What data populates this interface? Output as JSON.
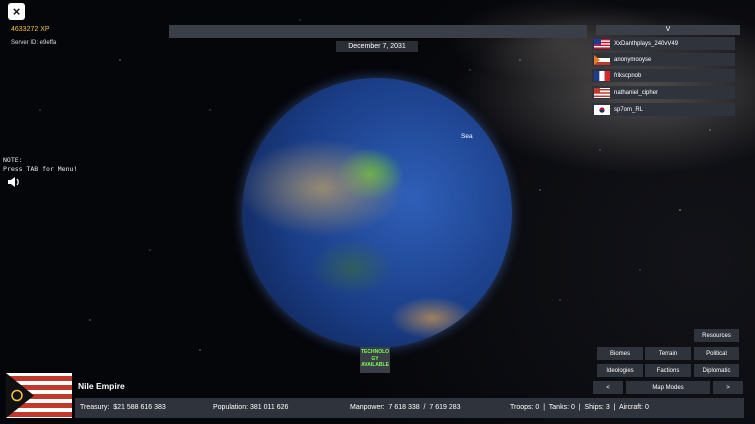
{
  "hud": {
    "xp": "4633272 XP",
    "server_id": "Server ID: e9effa",
    "note_line1": "NOTE:",
    "note_line2": "Press TAB for Menu!",
    "date": "December 7, 2031",
    "sea_label": "Sea",
    "tech_line1": "TECHNOLO",
    "tech_line2": "GY",
    "tech_line3": "AVAILABLE",
    "close_icon": "×"
  },
  "players": {
    "header": "V",
    "list": [
      {
        "name": "XxDanthplays_240vV49",
        "flag": "usa"
      },
      {
        "name": "anonymooyse",
        "flag": "striped"
      },
      {
        "name": "frikscpnob",
        "flag": "france"
      },
      {
        "name": "nathaniel_cipher",
        "flag": "striped-red"
      },
      {
        "name": "sp7om_RL",
        "flag": "korea"
      }
    ]
  },
  "map_modes": {
    "resources": "Resources",
    "biomes": "Biomes",
    "terrain": "Terrain",
    "political": "Political",
    "ideologies": "Ideologies",
    "factions": "Factions",
    "diplomatic": "Diplomatic",
    "prev": "<",
    "label": "Map Modes",
    "next": ">"
  },
  "empire": {
    "name": "Nile Empire",
    "treasury": "Treasury:  $21 588 616 383",
    "population": "Population: 381 011 626",
    "manpower": "Manpower:  7 618 338  /  7 619 283",
    "military": "Troops: 0  |  Tanks: 0  |  Ships: 3  |  Aircraft: 0"
  },
  "colors": {
    "accent_xp": "#f5c242",
    "tech_green": "#7cff57",
    "panel": "#2f333b"
  }
}
